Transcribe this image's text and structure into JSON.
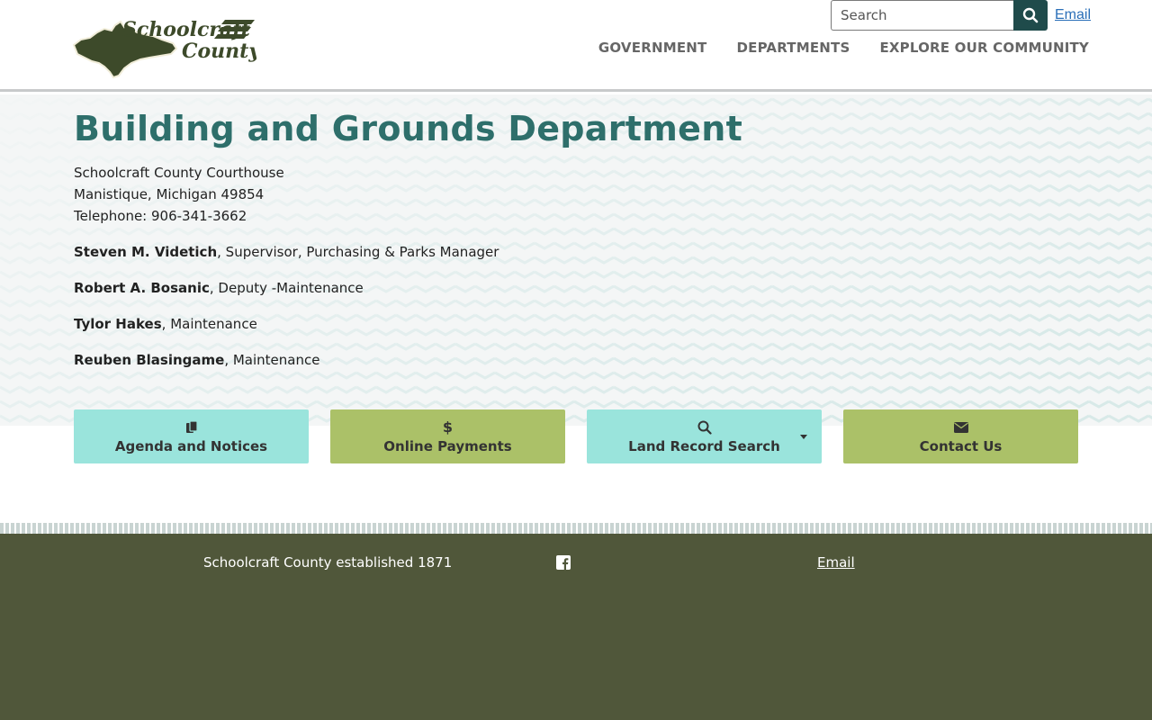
{
  "header": {
    "logo_text_line1": "Schoolcraft",
    "logo_text_line2": "County",
    "search": {
      "placeholder": "Search"
    },
    "email_link": "Email",
    "nav": [
      "GOVERNMENT",
      "DEPARTMENTS",
      "EXPLORE OUR COMMUNITY"
    ]
  },
  "main": {
    "title": "Building and Grounds Department",
    "address": {
      "line1": "Schoolcraft County Courthouse",
      "line2": "Manistique, Michigan 49854",
      "phone": "Telephone: 906-341-3662"
    },
    "staff": [
      {
        "name": "Steven M. Videtich",
        "role": ", Supervisor, Purchasing & Parks Manager"
      },
      {
        "name": "Robert A. Bosanic",
        "role": ", Deputy -Maintenance"
      },
      {
        "name": "Tylor Hakes",
        "role": ", Maintenance"
      },
      {
        "name": "Reuben Blasingame",
        "role": ", Maintenance"
      }
    ]
  },
  "quick_links": [
    {
      "label": "Agenda and Notices",
      "icon": "clipboard-icon",
      "color": "#9ae4dc"
    },
    {
      "label": "Online Payments",
      "icon": "dollar-icon",
      "color": "#abc168"
    },
    {
      "label": "Land Record Search",
      "icon": "search-icon",
      "color": "#9ae4dc"
    },
    {
      "label": "Contact Us",
      "icon": "envelope-icon",
      "color": "#abc168"
    }
  ],
  "footer": {
    "established": "Schoolcraft County established 1871",
    "social_icon": "facebook-icon",
    "email_link": "Email"
  },
  "colors": {
    "title": "#2e6f6b",
    "search_button": "#1f4b4b",
    "footer_bg": "#50573a",
    "teal": "#9ae4dc",
    "olive": "#abc168"
  }
}
